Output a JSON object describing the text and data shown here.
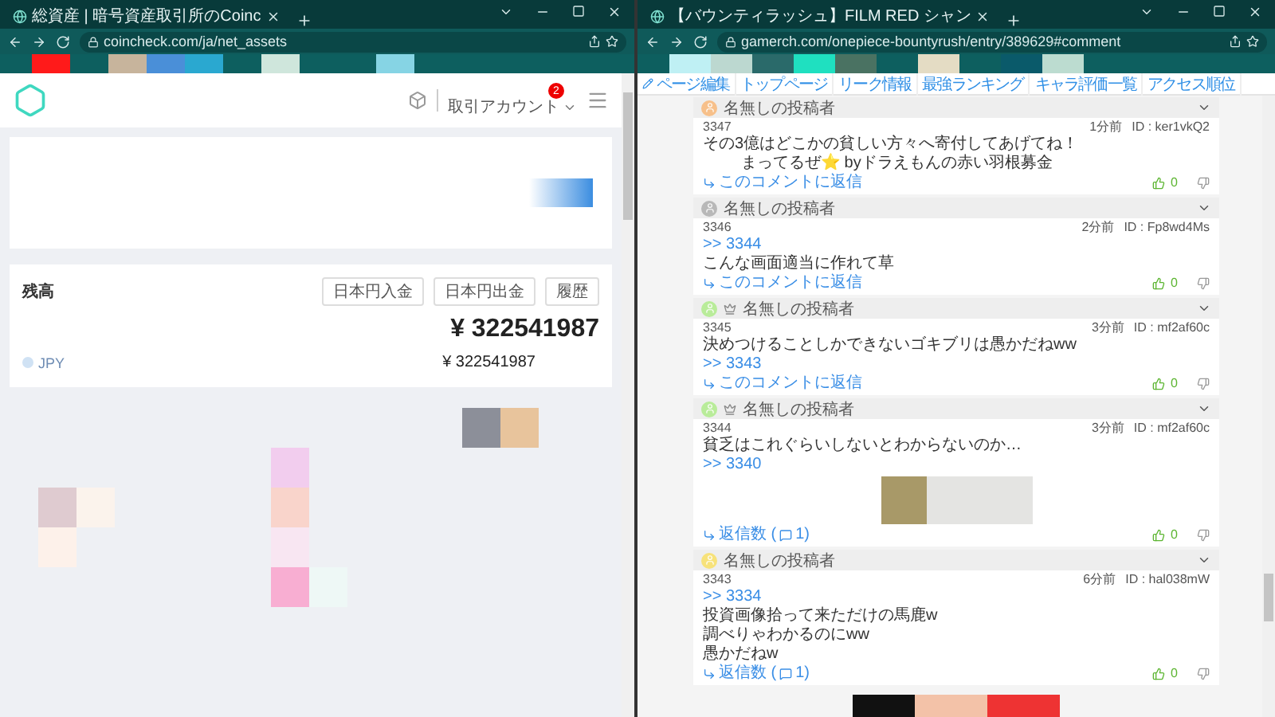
{
  "left_window": {
    "tab": {
      "title": "総資産 | 暗号資産取引所のCoinc"
    },
    "address": "coincheck.com/ja/net_assets",
    "header": {
      "account_menu": "取引アカウント",
      "badge": "2"
    },
    "balance_card": {
      "title": "残高",
      "buttons": [
        "日本円入金",
        "日本円出金",
        "履歴"
      ],
      "total": "¥ 322541987",
      "rows": [
        {
          "currency": "JPY",
          "amount": "¥ 322541987"
        }
      ]
    }
  },
  "right_window": {
    "tab": {
      "title": "【バウンティラッシュ】FILM RED シャン"
    },
    "address": "gamerch.com/onepiece-bountyrush/entry/389629#comment",
    "nav": [
      {
        "label": "ページ編集",
        "kind": "edit"
      },
      {
        "label": "トップページ",
        "kind": "link"
      },
      {
        "label": "リーク情報",
        "kind": "link"
      },
      {
        "label": "最強ランキング",
        "kind": "link"
      },
      {
        "label": "キャラ評価一覧",
        "kind": "link"
      },
      {
        "label": "アクセス順位",
        "kind": "link"
      }
    ],
    "comments": [
      {
        "name": "名無しの投稿者",
        "crown": false,
        "color": "#f7c08a",
        "number": "3347",
        "time": "1分前",
        "id": "ID : ker1vkQ2",
        "blocks": [
          {
            "kind": "text",
            "text": "その3億はどこかの貧しい方々へ寄付してあげてね！"
          },
          {
            "kind": "indent",
            "text": "まってるぜ⭐ byドラえもんの赤い羽根募金"
          }
        ],
        "footer": {
          "kind": "reply_link",
          "text": "このコメントに返信"
        },
        "likes": "0"
      },
      {
        "name": "名無しの投稿者",
        "crown": false,
        "color": "#b8b8b8",
        "number": "3346",
        "time": "2分前",
        "id": "ID : Fp8wd4Ms",
        "blocks": [
          {
            "kind": "anchor",
            "text": ">> 3344"
          },
          {
            "kind": "text",
            "text": "こんな画面適当に作れて草"
          }
        ],
        "footer": {
          "kind": "reply_link",
          "text": "このコメントに返信"
        },
        "likes": "0"
      },
      {
        "name": "名無しの投稿者",
        "crown": true,
        "color": "#b9ec9a",
        "number": "3345",
        "time": "3分前",
        "id": "ID : mf2af60c",
        "blocks": [
          {
            "kind": "text",
            "text": "決めつけることしかできないゴキブリは愚かだねww"
          },
          {
            "kind": "anchor",
            "text": ">> 3343"
          }
        ],
        "footer": {
          "kind": "reply_link",
          "text": "このコメントに返信"
        },
        "likes": "0"
      },
      {
        "name": "名無しの投稿者",
        "crown": true,
        "color": "#b9ec9a",
        "number": "3344",
        "time": "3分前",
        "id": "ID : mf2af60c",
        "blocks": [
          {
            "kind": "text",
            "text": "貧乏はこれぐらいしないとわからないのか…"
          },
          {
            "kind": "anchor",
            "text": ">> 3340"
          },
          {
            "kind": "photo"
          }
        ],
        "footer": {
          "kind": "reply_count",
          "text": "返信数 (",
          "count": "1)"
        },
        "likes": "0"
      },
      {
        "name": "名無しの投稿者",
        "crown": false,
        "color": "#f7e27a",
        "number": "3343",
        "time": "6分前",
        "id": "ID : hal038mW",
        "blocks": [
          {
            "kind": "anchor",
            "text": ">> 3334"
          },
          {
            "kind": "text",
            "text": "投資画像拾って来ただけの馬鹿w"
          },
          {
            "kind": "text",
            "text": "調べりゃわかるのにww"
          },
          {
            "kind": "text",
            "text": "愚かだねw"
          }
        ],
        "footer": {
          "kind": "reply_count",
          "text": "返信数 (",
          "count": "1)"
        },
        "likes": "0"
      }
    ]
  }
}
